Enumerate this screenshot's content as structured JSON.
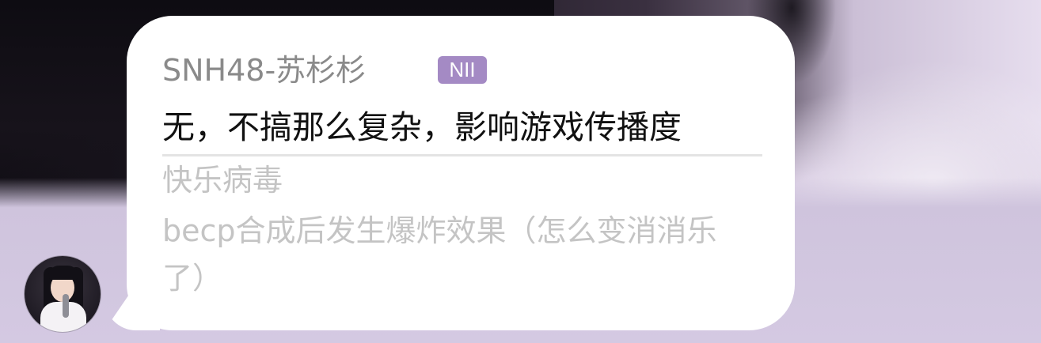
{
  "message": {
    "sender_name": "SNH48-苏杉杉",
    "team_badge": "NII",
    "text": "无，不搞那么复杂，影响游戏传播度",
    "quoted": {
      "author": "快乐病毒",
      "text": "becp合成后发生爆炸效果（怎么变消消乐了）"
    }
  },
  "colors": {
    "badge": "#a48ac4",
    "sender": "#8a8a8a",
    "message": "#111111",
    "quote": "#c4c4c4",
    "bubble": "#ffffff"
  },
  "avatar": {
    "icon": "user-avatar-photo"
  }
}
